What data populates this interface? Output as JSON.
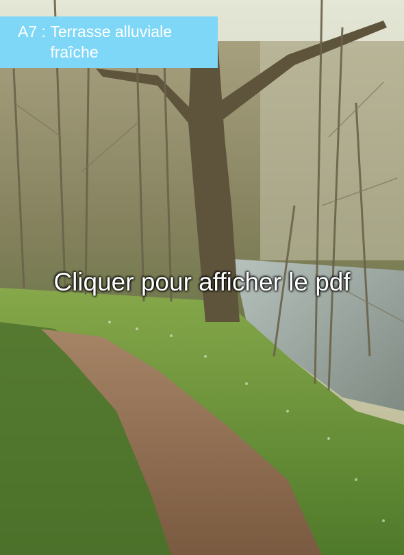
{
  "card": {
    "code": "A7",
    "separator": " : ",
    "title": "Terrasse alluviale fraîche",
    "action_label": "Cliquer pour afficher le pdf"
  },
  "photo": {
    "subject": "forest-path-by-river",
    "colors": {
      "sky": "#d8dcc8",
      "trees": "#8a8060",
      "river": "#9aa8a4",
      "grass": "#6f9a3a",
      "path": "#8a6a4c"
    }
  },
  "colors": {
    "title_background": "#7fd7f7",
    "text": "#ffffff"
  }
}
